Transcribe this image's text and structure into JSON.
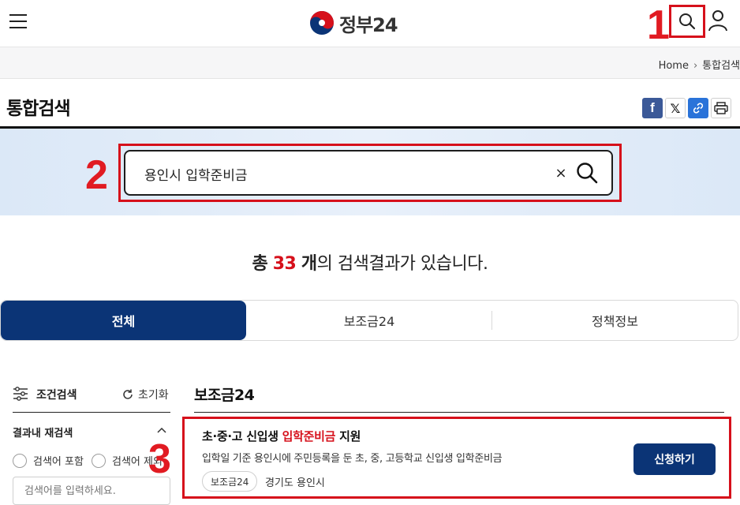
{
  "header": {
    "logo_text": "정부24",
    "menu_icon": "hamburger-menu-icon",
    "search_icon": "search-icon",
    "user_icon": "user-icon"
  },
  "markers": {
    "m1": "1",
    "m2": "2",
    "m3": "3"
  },
  "breadcrumb": {
    "home": "Home",
    "current": "통합검색"
  },
  "page": {
    "title": "통합검색",
    "share": [
      "facebook-icon",
      "x-icon",
      "link-icon",
      "print-icon"
    ]
  },
  "search": {
    "value": "용인시 입학준비금",
    "clear_label": "×"
  },
  "results": {
    "prefix": "총",
    "count": "33",
    "unit": "개",
    "suffix": "의 검색결과가 있습니다."
  },
  "tabs": [
    {
      "label": "전체",
      "active": true
    },
    {
      "label": "보조금24",
      "active": false
    },
    {
      "label": "정책정보",
      "active": false
    }
  ],
  "filter": {
    "title": "조건검색",
    "reset": "초기화",
    "refine_title": "결과내 재검색",
    "option_include": "검색어 포함",
    "option_exclude": "검색어 제외",
    "placeholder": "검색어를 입력하세요."
  },
  "section": {
    "title": "보조금24",
    "card": {
      "title_pre": "초·중·고 신입생 ",
      "title_highlight": "입학준비금",
      "title_post": " 지원",
      "description": "입학일 기준 용인시에 주민등록을 둔 초, 중, 고등학교 신입생 입학준비금",
      "tag": "보조금24",
      "region": "경기도 용인시",
      "apply_label": "신청하기"
    }
  },
  "colors": {
    "primary": "#0b3476",
    "highlight": "#d6101b",
    "band": "#e3edf9"
  }
}
